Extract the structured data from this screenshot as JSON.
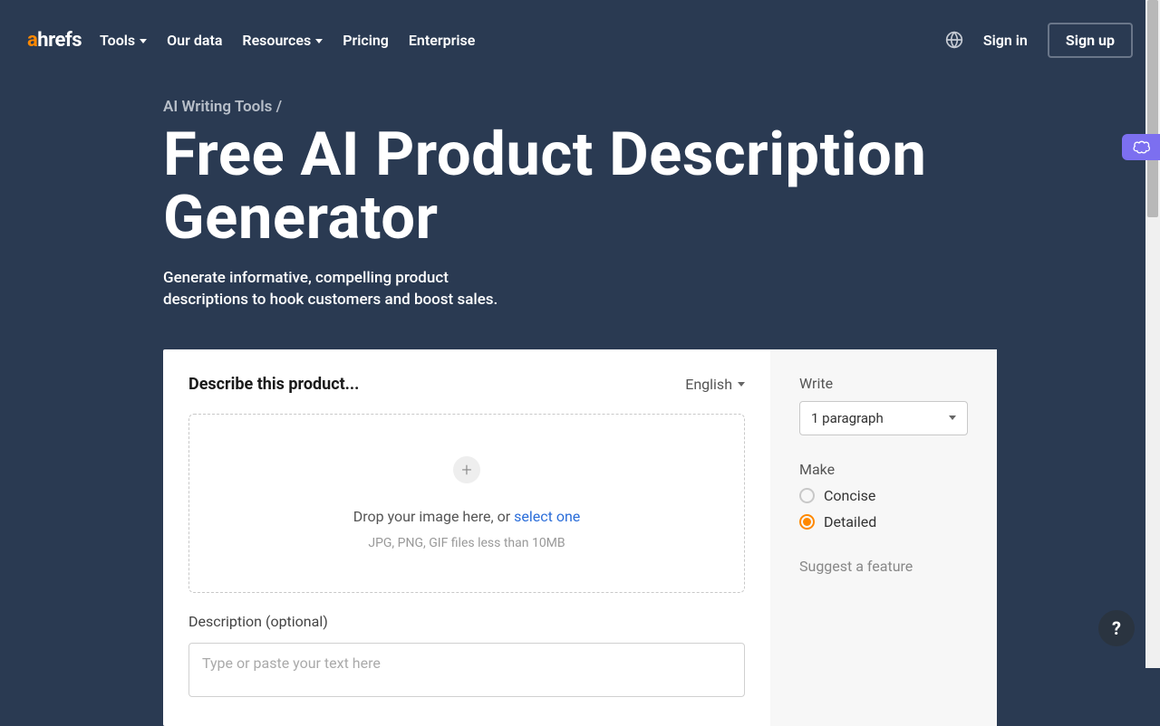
{
  "header": {
    "logo": {
      "a": "a",
      "rest": "hrefs"
    },
    "nav": {
      "tools": "Tools",
      "our_data": "Our data",
      "resources": "Resources",
      "pricing": "Pricing",
      "enterprise": "Enterprise"
    },
    "sign_in": "Sign in",
    "sign_up": "Sign up"
  },
  "breadcrumb": "AI Writing Tools /",
  "title": "Free AI Product Description Generator",
  "subtitle": "Generate informative, compelling product descriptions to hook customers and boost sales.",
  "generator": {
    "describe_label": "Describe this product...",
    "language": "English",
    "dropzone": {
      "text_prefix": "Drop your image here, or ",
      "text_link": "select one",
      "hint": "JPG, PNG, GIF files less than 10MB"
    },
    "description_label": "Description (optional)",
    "description_placeholder": "Type or paste your text here"
  },
  "sidebar": {
    "write_label": "Write",
    "write_value": "1 paragraph",
    "make_label": "Make",
    "options": {
      "concise": "Concise",
      "detailed": "Detailed"
    },
    "suggest": "Suggest a feature"
  },
  "help": "?"
}
